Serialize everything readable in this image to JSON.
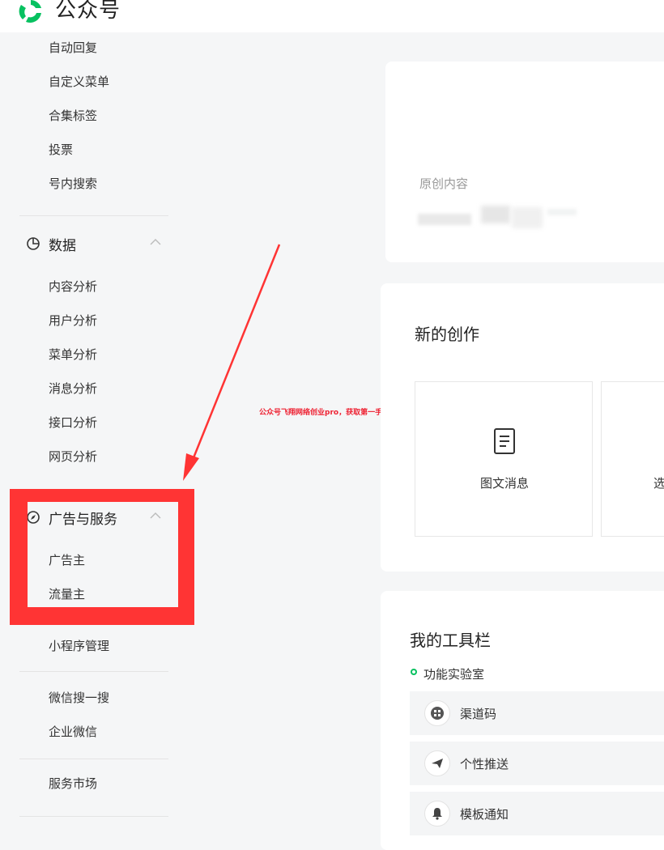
{
  "header": {
    "brand": "公众号"
  },
  "sidebar": {
    "top_items": [
      "自动回复",
      "自定义菜单",
      "合集标签",
      "投票",
      "号内搜索"
    ],
    "data_section": {
      "label": "数据",
      "items": [
        "内容分析",
        "用户分析",
        "菜单分析",
        "消息分析",
        "接口分析",
        "网页分析"
      ]
    },
    "ads_section": {
      "label": "广告与服务",
      "items": [
        "广告主",
        "流量主"
      ]
    },
    "mini_program": "小程序管理",
    "search_items": [
      "微信搜一搜",
      "企业微信"
    ],
    "service_market": "服务市场"
  },
  "watermark": "公众号飞翔网络创业pro，获取第一手项目",
  "main": {
    "original_content_label": "原创内容",
    "new_creation": {
      "title": "新的创作",
      "options": [
        "图文消息",
        "选"
      ]
    },
    "toolbar": {
      "title": "我的工具栏",
      "lab_label": "功能实验室",
      "tools": [
        {
          "label": "渠道码",
          "icon": "qrcode-icon"
        },
        {
          "label": "个性推送",
          "icon": "paper-plane-icon"
        },
        {
          "label": "模板通知",
          "icon": "bell-icon"
        }
      ]
    }
  },
  "colors": {
    "brand_green": "#07c160",
    "highlight_red": "#ff3434",
    "background": "#f5f6f7"
  }
}
